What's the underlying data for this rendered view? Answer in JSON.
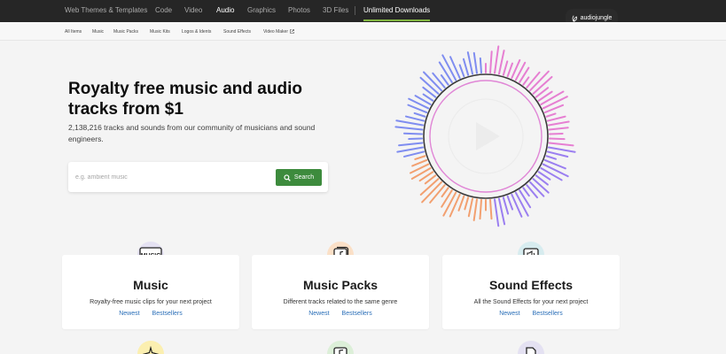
{
  "topnav": {
    "items": [
      {
        "label": "Web Themes & Templates"
      },
      {
        "label": "Code"
      },
      {
        "label": "Video"
      },
      {
        "label": "Audio"
      },
      {
        "label": "Graphics"
      },
      {
        "label": "Photos"
      },
      {
        "label": "3D Files"
      }
    ],
    "unlimited_label": "Unlimited Downloads",
    "brand_label": "audiojungle",
    "accent_color": "#82b541"
  },
  "subnav": {
    "items": [
      {
        "label": "All Items"
      },
      {
        "label": "Music"
      },
      {
        "label": "Music Packs"
      },
      {
        "label": "Music Kits"
      },
      {
        "label": "Logos & Idents"
      },
      {
        "label": "Sound Effects"
      },
      {
        "label": "Video Maker"
      }
    ]
  },
  "hero": {
    "title": "Royalty free music and audio tracks from $1",
    "subtitle": "2,138,216 tracks and sounds from our community of musicians and sound engineers."
  },
  "search": {
    "placeholder": "e.g. ambient music",
    "button_label": "Search",
    "button_color": "#3d8b3d"
  },
  "cards": [
    {
      "title": "Music",
      "description": "Royalty-free music clips for your next project",
      "links": [
        "Newest",
        "Bestsellers"
      ],
      "icon": "music-label-icon"
    },
    {
      "title": "Music Packs",
      "description": "Different tracks related to the same genre",
      "links": [
        "Newest",
        "Bestsellers"
      ],
      "icon": "music-pack-icon"
    },
    {
      "title": "Sound Effects",
      "description": "All the Sound Effects for your next project",
      "links": [
        "Newest",
        "Bestsellers"
      ],
      "icon": "sound-effects-icon"
    }
  ],
  "lower_icons": [
    "sparkle-icon",
    "music-note-icon",
    "document-icon"
  ]
}
